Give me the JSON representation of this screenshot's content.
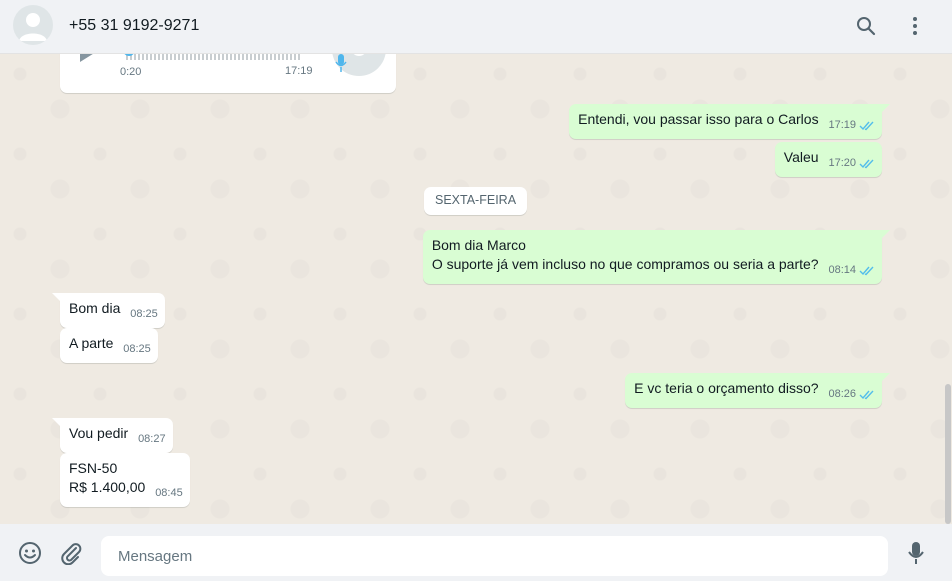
{
  "header": {
    "contact_name": "+55 31 9192-9271",
    "icons": [
      "avatar-placeholder",
      "search-icon",
      "menu-icon"
    ]
  },
  "audio_message": {
    "duration": "0:20",
    "time": "17:19",
    "icons": [
      "play-icon",
      "mic-icon"
    ]
  },
  "messages": [
    {
      "direction": "out",
      "text": "Entendi, vou passar isso para o Carlos",
      "time": "17:19",
      "status": "read"
    },
    {
      "direction": "out",
      "text": "Valeu",
      "time": "17:20",
      "status": "read"
    },
    {
      "type": "date",
      "text": "SEXTA-FEIRA"
    },
    {
      "direction": "out",
      "lines": [
        "Bom dia Marco",
        "O suporte já vem incluso no que compramos ou seria a parte?"
      ],
      "time": "08:14",
      "status": "read"
    },
    {
      "direction": "in",
      "text": "Bom dia",
      "time": "08:25"
    },
    {
      "direction": "in",
      "text": "A parte",
      "time": "08:25"
    },
    {
      "direction": "out",
      "text": "E vc teria o orçamento disso?",
      "time": "08:26",
      "status": "read"
    },
    {
      "direction": "in",
      "text": "Vou pedir",
      "time": "08:27"
    },
    {
      "direction": "in",
      "lines": [
        "FSN-50",
        "R$ 1.400,00"
      ],
      "time": "08:45"
    }
  ],
  "footer": {
    "placeholder": "Mensagem",
    "value": "",
    "icons": [
      "emoji-icon",
      "attach-icon",
      "mic-icon"
    ]
  },
  "colors": {
    "outgoing_bubble": "#d9fdd3",
    "incoming_bubble": "#ffffff",
    "read_ticks": "#53bdeb",
    "chat_background": "#efeae2"
  }
}
